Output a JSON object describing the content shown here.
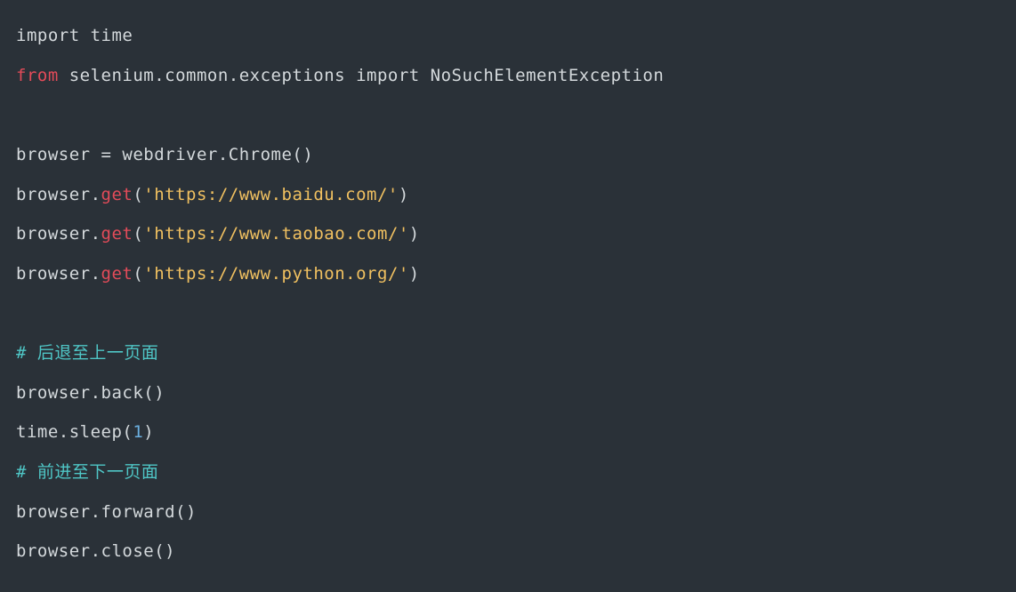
{
  "code": {
    "lines": [
      {
        "tokens": [
          {
            "cls": "kw-import",
            "text": "import"
          },
          {
            "cls": "plain",
            "text": " time"
          }
        ]
      },
      {
        "tokens": [
          {
            "cls": "kw-from",
            "text": "from"
          },
          {
            "cls": "plain",
            "text": " selenium.common.exceptions "
          },
          {
            "cls": "kw-import",
            "text": "import"
          },
          {
            "cls": "plain",
            "text": " NoSuchElementException"
          }
        ]
      },
      {
        "tokens": [
          {
            "cls": "plain",
            "text": " "
          }
        ]
      },
      {
        "tokens": [
          {
            "cls": "plain",
            "text": "browser = webdriver.Chrome()"
          }
        ]
      },
      {
        "tokens": [
          {
            "cls": "plain",
            "text": "browser."
          },
          {
            "cls": "call",
            "text": "get"
          },
          {
            "cls": "paren",
            "text": "("
          },
          {
            "cls": "string",
            "text": "'https://www.baidu.com/'"
          },
          {
            "cls": "paren",
            "text": ")"
          }
        ]
      },
      {
        "tokens": [
          {
            "cls": "plain",
            "text": "browser."
          },
          {
            "cls": "call",
            "text": "get"
          },
          {
            "cls": "paren",
            "text": "("
          },
          {
            "cls": "string",
            "text": "'https://www.taobao.com/'"
          },
          {
            "cls": "paren",
            "text": ")"
          }
        ]
      },
      {
        "tokens": [
          {
            "cls": "plain",
            "text": "browser."
          },
          {
            "cls": "call",
            "text": "get"
          },
          {
            "cls": "paren",
            "text": "("
          },
          {
            "cls": "string",
            "text": "'https://www.python.org/'"
          },
          {
            "cls": "paren",
            "text": ")"
          }
        ]
      },
      {
        "tokens": [
          {
            "cls": "plain",
            "text": " "
          }
        ]
      },
      {
        "tokens": [
          {
            "cls": "comment",
            "text": "# 后退至上一页面"
          }
        ]
      },
      {
        "tokens": [
          {
            "cls": "plain",
            "text": "browser.back()"
          }
        ]
      },
      {
        "tokens": [
          {
            "cls": "plain",
            "text": "time.sleep("
          },
          {
            "cls": "num",
            "text": "1"
          },
          {
            "cls": "plain",
            "text": ")"
          }
        ]
      },
      {
        "tokens": [
          {
            "cls": "comment",
            "text": "# 前进至下一页面"
          }
        ]
      },
      {
        "tokens": [
          {
            "cls": "plain",
            "text": "browser.forward()"
          }
        ]
      },
      {
        "tokens": [
          {
            "cls": "plain",
            "text": "browser.close()"
          }
        ]
      }
    ]
  }
}
